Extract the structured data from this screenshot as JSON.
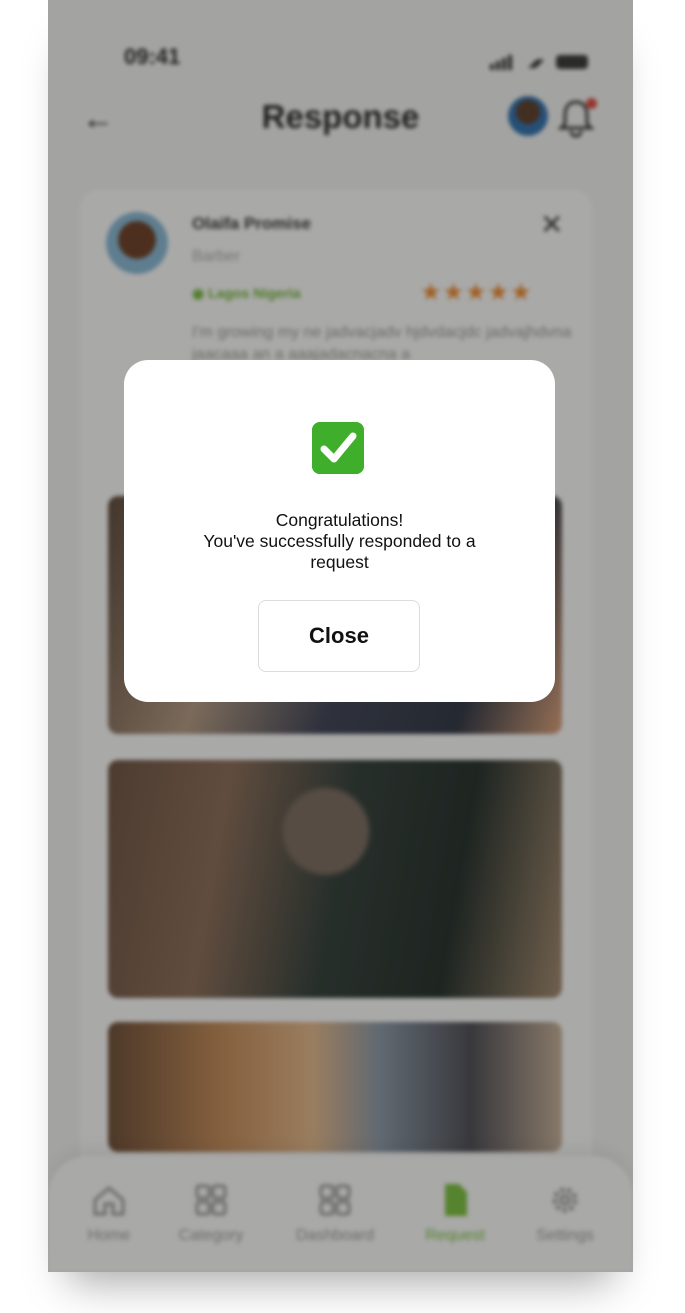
{
  "status_bar": {
    "time": "09:41"
  },
  "header": {
    "title": "Response"
  },
  "provider": {
    "name": "Olaifa Promise",
    "role": "Barber",
    "location": "Lagos Nigeria",
    "rating": 5,
    "stars": "★★★★★",
    "description": "I'm growing my ne jadvacjadv hjdvdacjdc jadvajhdvna jaacaaa an a aaajadacnacna a"
  },
  "nav": [
    {
      "label": "Home",
      "icon": "home-icon"
    },
    {
      "label": "Category",
      "icon": "category-icon"
    },
    {
      "label": "Dashboard",
      "icon": "dashboard-icon"
    },
    {
      "label": "Request",
      "icon": "request-icon",
      "active": true
    },
    {
      "label": "Settings",
      "icon": "settings-icon"
    }
  ],
  "modal": {
    "icon": "check-mark-icon",
    "line1": "Congratulations!",
    "line2": "You've successfully responded to a",
    "line3": "request",
    "close_label": "Close"
  },
  "colors": {
    "accent": "#78c23a",
    "star": "#f0892b",
    "badge": "#e0443a",
    "check": "#3fae2a"
  }
}
